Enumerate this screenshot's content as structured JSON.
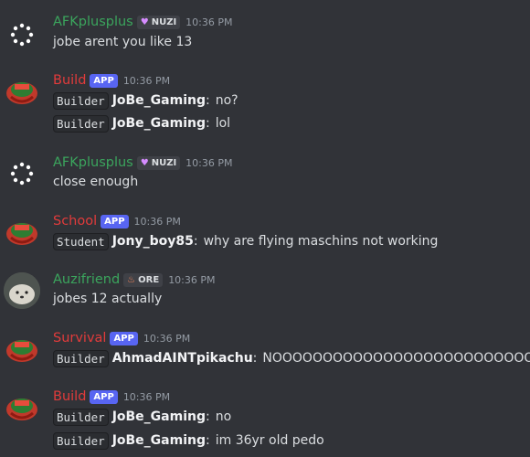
{
  "messages": [
    {
      "author": "AFKplusplus",
      "author_color": "#3ba55d",
      "tag": "NUZI",
      "tag_type": "guild",
      "tag_icon": "heart-icon",
      "time": "10:36 PM",
      "avatar": "dots-avatar",
      "lines": [
        {
          "text": "jobe arent you like 13"
        }
      ]
    },
    {
      "author": "Build",
      "author_color": "#e23b3b",
      "tag": "APP",
      "tag_type": "app",
      "time": "10:36 PM",
      "avatar": "server-avatar",
      "lines": [
        {
          "role": "Builder",
          "user": "JoBe_Gaming",
          "colon": ":",
          "text": "no?"
        },
        {
          "role": "Builder",
          "user": "JoBe_Gaming",
          "colon": ":",
          "text": "lol"
        }
      ]
    },
    {
      "author": "AFKplusplus",
      "author_color": "#3ba55d",
      "tag": "NUZI",
      "tag_type": "guild",
      "tag_icon": "heart-icon",
      "time": "10:36 PM",
      "avatar": "dots-avatar",
      "lines": [
        {
          "text": "close enough"
        }
      ]
    },
    {
      "author": "School",
      "author_color": "#e23b3b",
      "tag": "APP",
      "tag_type": "app",
      "time": "10:36 PM",
      "avatar": "server-avatar",
      "lines": [
        {
          "role": "Student",
          "user": "Jony_boy85",
          "colon": ":",
          "text": "why are flying maschins not working"
        }
      ]
    },
    {
      "author": "Auzifriend",
      "author_color": "#3ba55d",
      "tag": "ORE",
      "tag_type": "guild",
      "tag_icon": "flame-icon",
      "time": "10:36 PM",
      "avatar": "seal-avatar",
      "lines": [
        {
          "text": "jobes 12 actually"
        }
      ]
    },
    {
      "author": "Survival",
      "author_color": "#e23b3b",
      "tag": "APP",
      "tag_type": "app",
      "time": "10:36 PM",
      "avatar": "server-avatar",
      "lines": [
        {
          "role": "Builder",
          "user": "AhmadAINTpikachu",
          "colon": ":",
          "text": "NOOOOOOOOOOOOOOOOOOOOOOOOOOOO"
        }
      ]
    },
    {
      "author": "Build",
      "author_color": "#e23b3b",
      "tag": "APP",
      "tag_type": "app",
      "time": "10:36 PM",
      "avatar": "server-avatar",
      "lines": [
        {
          "role": "Builder",
          "user": "JoBe_Gaming",
          "colon": ":",
          "text": "no"
        },
        {
          "role": "Builder",
          "user": "JoBe_Gaming",
          "colon": ":",
          "text": "im 36yr old pedo"
        }
      ]
    }
  ],
  "colors": {
    "background": "#313338",
    "green": "#3ba55d",
    "red": "#e23b3b",
    "app_badge": "#5865f2"
  }
}
